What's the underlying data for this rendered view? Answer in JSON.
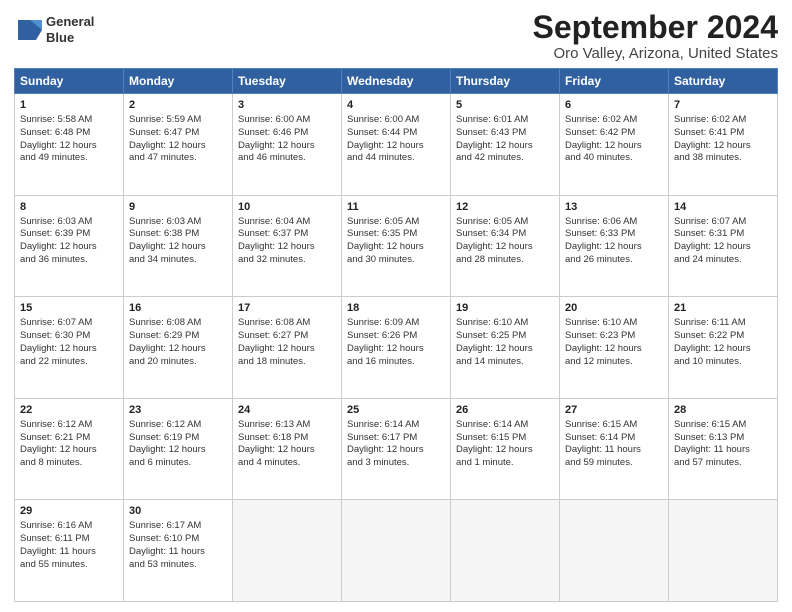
{
  "logo": {
    "line1": "General",
    "line2": "Blue"
  },
  "title": "September 2024",
  "subtitle": "Oro Valley, Arizona, United States",
  "header_days": [
    "Sunday",
    "Monday",
    "Tuesday",
    "Wednesday",
    "Thursday",
    "Friday",
    "Saturday"
  ],
  "weeks": [
    [
      {
        "day": "1",
        "lines": [
          "Sunrise: 5:58 AM",
          "Sunset: 6:48 PM",
          "Daylight: 12 hours",
          "and 49 minutes."
        ]
      },
      {
        "day": "2",
        "lines": [
          "Sunrise: 5:59 AM",
          "Sunset: 6:47 PM",
          "Daylight: 12 hours",
          "and 47 minutes."
        ]
      },
      {
        "day": "3",
        "lines": [
          "Sunrise: 6:00 AM",
          "Sunset: 6:46 PM",
          "Daylight: 12 hours",
          "and 46 minutes."
        ]
      },
      {
        "day": "4",
        "lines": [
          "Sunrise: 6:00 AM",
          "Sunset: 6:44 PM",
          "Daylight: 12 hours",
          "and 44 minutes."
        ]
      },
      {
        "day": "5",
        "lines": [
          "Sunrise: 6:01 AM",
          "Sunset: 6:43 PM",
          "Daylight: 12 hours",
          "and 42 minutes."
        ]
      },
      {
        "day": "6",
        "lines": [
          "Sunrise: 6:02 AM",
          "Sunset: 6:42 PM",
          "Daylight: 12 hours",
          "and 40 minutes."
        ]
      },
      {
        "day": "7",
        "lines": [
          "Sunrise: 6:02 AM",
          "Sunset: 6:41 PM",
          "Daylight: 12 hours",
          "and 38 minutes."
        ]
      }
    ],
    [
      {
        "day": "8",
        "lines": [
          "Sunrise: 6:03 AM",
          "Sunset: 6:39 PM",
          "Daylight: 12 hours",
          "and 36 minutes."
        ]
      },
      {
        "day": "9",
        "lines": [
          "Sunrise: 6:03 AM",
          "Sunset: 6:38 PM",
          "Daylight: 12 hours",
          "and 34 minutes."
        ]
      },
      {
        "day": "10",
        "lines": [
          "Sunrise: 6:04 AM",
          "Sunset: 6:37 PM",
          "Daylight: 12 hours",
          "and 32 minutes."
        ]
      },
      {
        "day": "11",
        "lines": [
          "Sunrise: 6:05 AM",
          "Sunset: 6:35 PM",
          "Daylight: 12 hours",
          "and 30 minutes."
        ]
      },
      {
        "day": "12",
        "lines": [
          "Sunrise: 6:05 AM",
          "Sunset: 6:34 PM",
          "Daylight: 12 hours",
          "and 28 minutes."
        ]
      },
      {
        "day": "13",
        "lines": [
          "Sunrise: 6:06 AM",
          "Sunset: 6:33 PM",
          "Daylight: 12 hours",
          "and 26 minutes."
        ]
      },
      {
        "day": "14",
        "lines": [
          "Sunrise: 6:07 AM",
          "Sunset: 6:31 PM",
          "Daylight: 12 hours",
          "and 24 minutes."
        ]
      }
    ],
    [
      {
        "day": "15",
        "lines": [
          "Sunrise: 6:07 AM",
          "Sunset: 6:30 PM",
          "Daylight: 12 hours",
          "and 22 minutes."
        ]
      },
      {
        "day": "16",
        "lines": [
          "Sunrise: 6:08 AM",
          "Sunset: 6:29 PM",
          "Daylight: 12 hours",
          "and 20 minutes."
        ]
      },
      {
        "day": "17",
        "lines": [
          "Sunrise: 6:08 AM",
          "Sunset: 6:27 PM",
          "Daylight: 12 hours",
          "and 18 minutes."
        ]
      },
      {
        "day": "18",
        "lines": [
          "Sunrise: 6:09 AM",
          "Sunset: 6:26 PM",
          "Daylight: 12 hours",
          "and 16 minutes."
        ]
      },
      {
        "day": "19",
        "lines": [
          "Sunrise: 6:10 AM",
          "Sunset: 6:25 PM",
          "Daylight: 12 hours",
          "and 14 minutes."
        ]
      },
      {
        "day": "20",
        "lines": [
          "Sunrise: 6:10 AM",
          "Sunset: 6:23 PM",
          "Daylight: 12 hours",
          "and 12 minutes."
        ]
      },
      {
        "day": "21",
        "lines": [
          "Sunrise: 6:11 AM",
          "Sunset: 6:22 PM",
          "Daylight: 12 hours",
          "and 10 minutes."
        ]
      }
    ],
    [
      {
        "day": "22",
        "lines": [
          "Sunrise: 6:12 AM",
          "Sunset: 6:21 PM",
          "Daylight: 12 hours",
          "and 8 minutes."
        ]
      },
      {
        "day": "23",
        "lines": [
          "Sunrise: 6:12 AM",
          "Sunset: 6:19 PM",
          "Daylight: 12 hours",
          "and 6 minutes."
        ]
      },
      {
        "day": "24",
        "lines": [
          "Sunrise: 6:13 AM",
          "Sunset: 6:18 PM",
          "Daylight: 12 hours",
          "and 4 minutes."
        ]
      },
      {
        "day": "25",
        "lines": [
          "Sunrise: 6:14 AM",
          "Sunset: 6:17 PM",
          "Daylight: 12 hours",
          "and 3 minutes."
        ]
      },
      {
        "day": "26",
        "lines": [
          "Sunrise: 6:14 AM",
          "Sunset: 6:15 PM",
          "Daylight: 12 hours",
          "and 1 minute."
        ]
      },
      {
        "day": "27",
        "lines": [
          "Sunrise: 6:15 AM",
          "Sunset: 6:14 PM",
          "Daylight: 11 hours",
          "and 59 minutes."
        ]
      },
      {
        "day": "28",
        "lines": [
          "Sunrise: 6:15 AM",
          "Sunset: 6:13 PM",
          "Daylight: 11 hours",
          "and 57 minutes."
        ]
      }
    ],
    [
      {
        "day": "29",
        "lines": [
          "Sunrise: 6:16 AM",
          "Sunset: 6:11 PM",
          "Daylight: 11 hours",
          "and 55 minutes."
        ]
      },
      {
        "day": "30",
        "lines": [
          "Sunrise: 6:17 AM",
          "Sunset: 6:10 PM",
          "Daylight: 11 hours",
          "and 53 minutes."
        ]
      },
      {
        "day": "",
        "lines": []
      },
      {
        "day": "",
        "lines": []
      },
      {
        "day": "",
        "lines": []
      },
      {
        "day": "",
        "lines": []
      },
      {
        "day": "",
        "lines": []
      }
    ]
  ]
}
